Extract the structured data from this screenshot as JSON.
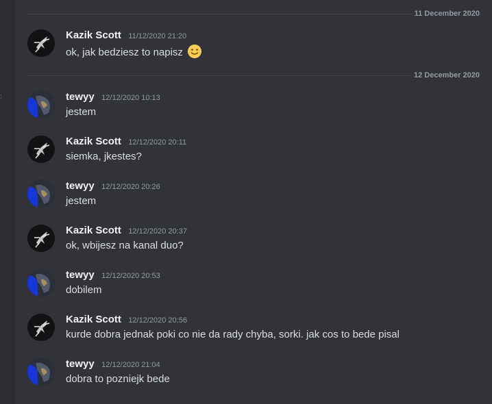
{
  "dividers": [
    {
      "label": "11 December 2020"
    },
    {
      "label": "12 December 2020"
    }
  ],
  "messages": [
    {
      "author": "Kazik Scott",
      "timestamp": "11/12/2020 21:20",
      "text": "ok, jak bedziesz to napisz",
      "emoji": "slightly-smiling-face-icon"
    },
    {
      "author": "tewyy",
      "timestamp": "12/12/2020 10:13",
      "text": "jestem"
    },
    {
      "author": "Kazik Scott",
      "timestamp": "12/12/2020 20:11",
      "text": "siemka, jkestes?"
    },
    {
      "author": "tewyy",
      "timestamp": "12/12/2020 20:26",
      "text": "jestem"
    },
    {
      "author": "Kazik Scott",
      "timestamp": "12/12/2020 20:37",
      "text": "ok, wbijesz na kanal duo?"
    },
    {
      "author": "tewyy",
      "timestamp": "12/12/2020 20:53",
      "text": "dobilem"
    },
    {
      "author": "Kazik Scott",
      "timestamp": "12/12/2020 20:56",
      "text": "kurde dobra jednak poki co nie da rady chyba, sorki. jak cos to bede pisal"
    },
    {
      "author": "tewyy",
      "timestamp": "12/12/2020 21:04",
      "text": "dobra to pozniejk bede"
    }
  ],
  "colors": {
    "background": "#313338",
    "sidebar_strip": "#2b2d31",
    "username": "#f2f3f5",
    "timestamp": "#949ba4",
    "message_text": "#dbdee1",
    "divider_line": "#3f4147",
    "emoji_yellow": "#fdcb58"
  },
  "icons": {
    "kazik_avatar": "dark-avatar-icon",
    "tewyy_avatar": "blue-avatar-icon",
    "emoji": "slightly-smiling-face-icon"
  }
}
